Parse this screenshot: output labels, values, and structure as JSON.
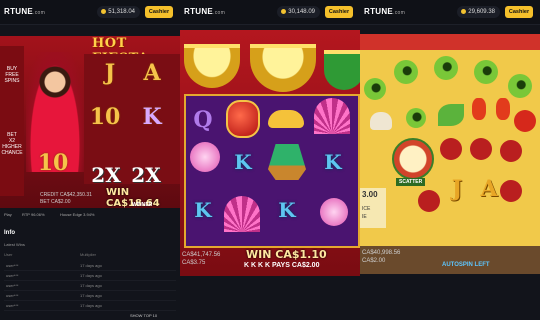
{
  "brand": {
    "name": "RTUNE",
    "suffix": ".com"
  },
  "panels": [
    {
      "balance": "51,318.04",
      "cashier": "Cashier",
      "game_title": "HOT FIESTA",
      "side_text": [
        "BUY",
        "FREE",
        "SPINS",
        "BET",
        "X2",
        "HIGHER",
        "CHANCE"
      ],
      "symbols": [
        "J",
        "A",
        "10",
        "K",
        "10",
        "2X",
        "2X"
      ],
      "credit_label": "CREDIT CA$42,350.31",
      "bet_label": "BET CA$2.00",
      "win_text": "WIN CA$18.64",
      "winner": "WINNER",
      "info_line": [
        "Play",
        "RTP 96.06%",
        "House Edge 3.94%"
      ],
      "section_title": "Info",
      "section_sub": "Latest Wins",
      "table_cols": [
        "User",
        "Multiplier"
      ],
      "rows": [
        {
          "user": "user***",
          "time": "17 days ago"
        },
        {
          "user": "user***",
          "time": "17 days ago"
        },
        {
          "user": "user***",
          "time": "17 days ago"
        },
        {
          "user": "user***",
          "time": "17 days ago"
        },
        {
          "user": "user***",
          "time": "17 days ago"
        }
      ],
      "show_more": "SHOW TOP 10"
    },
    {
      "balance": "30,148.09",
      "cashier": "Cashier",
      "symbols": [
        "Q",
        "K",
        "K",
        "K",
        "K"
      ],
      "balance_line": "CA$41,747.56",
      "bet_line": "CA$3.75",
      "win_text": "WIN CA$1.10",
      "pays_row": "K K K K PAYS CA$2.00"
    },
    {
      "balance": "29,609.38",
      "cashier": "Cashier",
      "scatter_label": "SCATTER",
      "symbols": [
        "J",
        "A"
      ],
      "price_partial": "3.00",
      "left_texts": [
        "ICE",
        "IE"
      ],
      "balance_line": "CA$40,998.56",
      "bet_line": "CA$2.00",
      "footer_text": "AUTOSPIN LEFT"
    }
  ],
  "colors": {
    "cashier": "#f5c02b",
    "coin": "#f2c230",
    "bg": "#0d0f14"
  }
}
